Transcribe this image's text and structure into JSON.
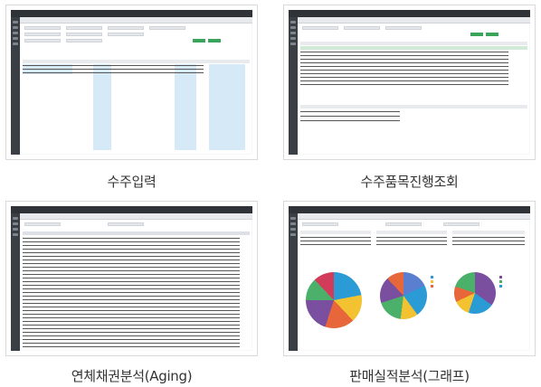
{
  "cards": [
    {
      "caption": "수주입력"
    },
    {
      "caption": "수주품목진행조회"
    },
    {
      "caption": "연체채권분석(Aging)"
    },
    {
      "caption": "판매실적분석(그래프)"
    }
  ],
  "colors": {
    "sidebar": "#3a3f45",
    "topbar": "#2f3338",
    "accent_green": "#3aa55a",
    "highlight_blue": "#d6e9f6",
    "highlight_green": "#cfead6"
  },
  "pie_colors": [
    "#2b9bd6",
    "#f2c230",
    "#e8673a",
    "#7a4fa0",
    "#4bb06a",
    "#d23c5a",
    "#5a7fd0"
  ]
}
